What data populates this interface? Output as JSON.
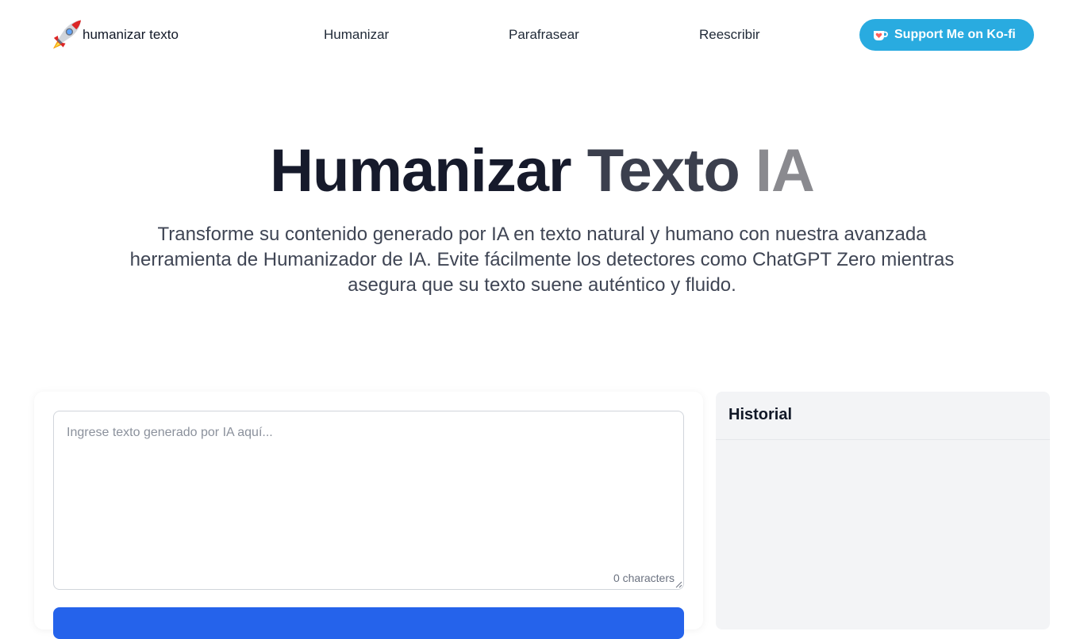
{
  "header": {
    "logo_text": "humanizar texto",
    "logo_icon": "rocket-icon",
    "nav": [
      {
        "label": "Humanizar"
      },
      {
        "label": "Parafrasear"
      },
      {
        "label": "Reescribir"
      }
    ],
    "kofi": {
      "label": "Support Me on Ko-fi",
      "icon": "kofi-cup-icon",
      "color": "#29abe0"
    }
  },
  "hero": {
    "title_part1": "Humanizar",
    "title_part2": "Texto",
    "title_part3": "IA",
    "subtitle": "Transforme su contenido generado por IA en texto natural y humano con nuestra avanzada herramienta de Humanizador de IA. Evite fácilmente los detectores como ChatGPT Zero mientras asegura que su texto suene auténtico y fluido."
  },
  "input": {
    "placeholder": "Ingrese texto generado por IA aquí...",
    "value": "",
    "char_count": "0 characters"
  },
  "history": {
    "title": "Historial"
  },
  "colors": {
    "accent": "#2563eb",
    "kofi": "#29abe0",
    "title_dark": "#161a2b",
    "title_mid": "#3b3f4d",
    "title_light": "#8a8a8f"
  }
}
